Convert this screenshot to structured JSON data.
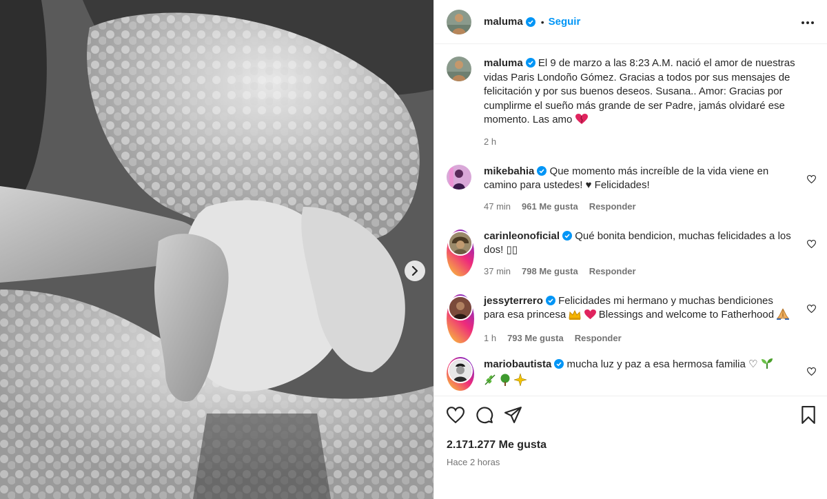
{
  "header": {
    "username": "maluma",
    "separator": "•",
    "follow_label": "Seguir"
  },
  "caption": {
    "username": "maluma",
    "text": "El 9 de marzo a las 8:23 A.M. nació el amor de nuestras vidas Paris Londoño Gómez. Gracias a todos por sus mensajes de felicitación y por sus buenos deseos. Susana.. Amor: Gracias por cumplirme el sueño más grande de ser Padre, jamás olvidaré ese momento. Las amo",
    "time": "2 h"
  },
  "comments": [
    {
      "username": "mikebahia",
      "text": "Que momento más increíble de la vida viene en camino para ustedes! ♥ Felicidades!",
      "time": "47 min",
      "likes": "961 Me gusta",
      "reply": "Responder"
    },
    {
      "username": "carinleonoficial",
      "text": "Qué bonita bendicion, muchas felicidades a los dos! ▯▯",
      "time": "37 min",
      "likes": "798 Me gusta",
      "reply": "Responder"
    },
    {
      "username": "jessyterrero",
      "text": "Felicidades mi hermano y muchas bendiciones para esa princesa",
      "text2": "Blessings and welcome to Fatherhood",
      "time": "1 h",
      "likes": "793 Me gusta",
      "reply": "Responder"
    },
    {
      "username": "mariobautista",
      "text": "mucha luz y paz a esa hermosa familia ♡"
    }
  ],
  "footer": {
    "likes": "2.171.277 Me gusta",
    "time": "Hace 2 horas"
  },
  "icons": {
    "verified": "verified-badge-icon",
    "more": "more-options-icon",
    "like": "heart-icon",
    "comment": "comment-icon",
    "share": "share-icon",
    "save": "bookmark-icon",
    "next": "chevron-right-icon"
  },
  "colors": {
    "accent": "#0095f6",
    "text": "#262626",
    "muted": "#737373"
  }
}
